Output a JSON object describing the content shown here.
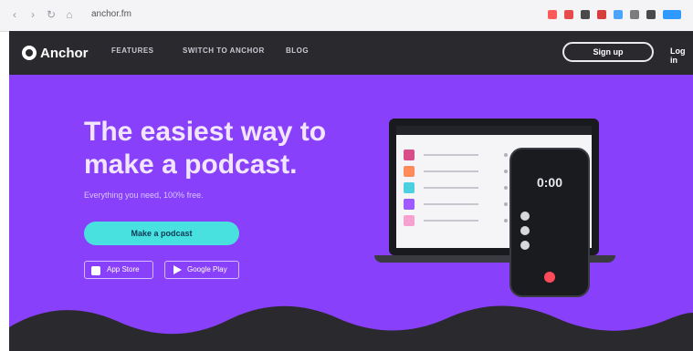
{
  "browser": {
    "url": "anchor.fm",
    "extensions": [
      "#ff5a5a",
      "#e84b4b",
      "#4a4a4a",
      "#d63d3d",
      "#4aa3ff",
      "#7c7c7c",
      "#4a4a4a",
      "#2e9aff"
    ]
  },
  "nav": {
    "brand": "Anchor",
    "links": [
      "FEATURES",
      "SWITCH TO ANCHOR",
      "BLOG"
    ],
    "signup": "Sign up",
    "login": "Log in"
  },
  "hero": {
    "headline_line1": "The easiest way to",
    "headline_line2": "make a podcast.",
    "subline": "Everything you need, 100% free.",
    "cta": "Make a podcast",
    "app_store": "App Store",
    "google_play": "Google Play"
  },
  "device": {
    "phone_time": "0:00"
  },
  "colors": {
    "purple": "#8940fa",
    "nav": "#2a2a2e",
    "cta": "#49e0e0",
    "dark_wave": "#2a2a2e"
  }
}
